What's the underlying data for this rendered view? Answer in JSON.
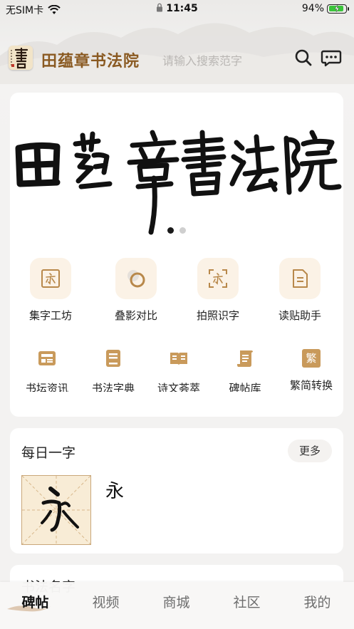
{
  "status_bar": {
    "carrier": "无SIM卡",
    "time": "11:45",
    "battery_percent": "94%",
    "battery_level": 0.94,
    "icons": [
      "wifi-icon",
      "lock-icon",
      "battery-charging-icon"
    ]
  },
  "header": {
    "app_title": "田蕴章书法院",
    "search_placeholder": "请输入搜索范字",
    "icons": [
      "seal-logo-icon",
      "search-icon",
      "message-icon"
    ]
  },
  "banner": {
    "calligraphy_text": "田蕴章書法院",
    "page_count": 2,
    "active_page": 1
  },
  "feature_grid": [
    {
      "label": "集字工坊",
      "icon": "collect-char-icon"
    },
    {
      "label": "叠影对比",
      "icon": "overlay-compare-icon"
    },
    {
      "label": "拍照识字",
      "icon": "photo-recognize-icon"
    },
    {
      "label": "读贴助手",
      "icon": "reading-assistant-icon"
    }
  ],
  "secondary_grid": [
    {
      "label": "书坛资讯",
      "icon": "news-icon"
    },
    {
      "label": "书法字典",
      "icon": "dictionary-icon"
    },
    {
      "label": "诗文荟萃",
      "icon": "poetry-book-icon"
    },
    {
      "label": "碑帖库",
      "icon": "stele-library-icon"
    },
    {
      "label": "繁简转换",
      "icon": "traditional-simplified-icon",
      "icon_text": "繁"
    }
  ],
  "daily_char": {
    "title": "每日一字",
    "more_label": "更多",
    "character": "永"
  },
  "next_section": {
    "title": "书法名字"
  },
  "tab_bar": {
    "tabs": [
      {
        "label": "碑帖",
        "active": true
      },
      {
        "label": "视频",
        "active": false
      },
      {
        "label": "商城",
        "active": false
      },
      {
        "label": "社区",
        "active": false
      },
      {
        "label": "我的",
        "active": false
      }
    ]
  },
  "colors": {
    "brand_brown": "#8a5a22",
    "icon_gold": "#b8884a",
    "icon_bg": "#fbf2e6",
    "charging_green": "#3ac43a"
  }
}
